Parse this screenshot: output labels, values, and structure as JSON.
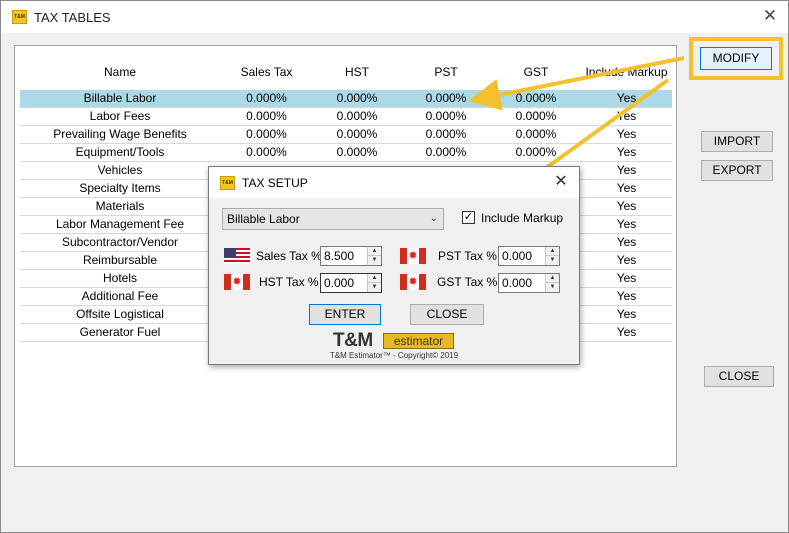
{
  "window": {
    "logo": "T&M",
    "title": "TAX TABLES",
    "close_glyph": "✕"
  },
  "table": {
    "headers": [
      "Name",
      "Sales Tax",
      "HST",
      "PST",
      "GST",
      "Include Markup"
    ],
    "rows": [
      [
        "Billable Labor",
        "0.000%",
        "0.000%",
        "0.000%",
        "0.000%",
        "Yes"
      ],
      [
        "Labor Fees",
        "0.000%",
        "0.000%",
        "0.000%",
        "0.000%",
        "Yes"
      ],
      [
        "Prevailing Wage Benefits",
        "0.000%",
        "0.000%",
        "0.000%",
        "0.000%",
        "Yes"
      ],
      [
        "Equipment/Tools",
        "0.000%",
        "0.000%",
        "0.000%",
        "0.000%",
        "Yes"
      ],
      [
        "Vehicles",
        "",
        "",
        "",
        "",
        "Yes"
      ],
      [
        "Specialty Items",
        "",
        "",
        "",
        "",
        "Yes"
      ],
      [
        "Materials",
        "",
        "",
        "",
        "",
        "Yes"
      ],
      [
        "Labor Management Fee",
        "",
        "",
        "",
        "",
        "Yes"
      ],
      [
        "Subcontractor/Vendor",
        "",
        "",
        "",
        "",
        "Yes"
      ],
      [
        "Reimbursable",
        "",
        "",
        "",
        "",
        "Yes"
      ],
      [
        "Hotels",
        "",
        "",
        "",
        "",
        "Yes"
      ],
      [
        "Additional Fee",
        "",
        "",
        "",
        "",
        "Yes"
      ],
      [
        "Offsite Logistical",
        "",
        "",
        "",
        "",
        "Yes"
      ],
      [
        "Generator Fuel",
        "",
        "",
        "",
        "",
        "Yes"
      ]
    ],
    "selected_row": 0
  },
  "buttons": {
    "modify": "MODIFY",
    "import": "IMPORT",
    "export": "EXPORT",
    "close": "CLOSE"
  },
  "colors": {
    "highlight": "#f2c12e",
    "selected_row": "#add8e6",
    "focus_blue": "#0078d7"
  },
  "dialog": {
    "logo": "T&M",
    "title": "TAX SETUP",
    "close_glyph": "✕",
    "category": "Billable Labor",
    "include_markup_label": "Include Markup",
    "include_markup_checked": true,
    "check_glyph": "✓",
    "sales_tax_label": "Sales Tax %",
    "sales_tax_value": "8.500",
    "hst_tax_label": "HST Tax %",
    "hst_tax_value": "0.000",
    "pst_tax_label": "PST Tax %",
    "pst_tax_value": "0.000",
    "gst_tax_label": "GST Tax %",
    "gst_tax_value": "0.000",
    "enter_label": "ENTER",
    "close_label": "CLOSE",
    "brand_tm": "T&M",
    "brand_estimator": "estimator",
    "copyright": "T&M Estimator™ - Copyright© 2019"
  },
  "icons": {
    "chevron": "chevron-down-icon",
    "spin_up": "▲",
    "spin_down": "▼",
    "leaf": "✹"
  }
}
